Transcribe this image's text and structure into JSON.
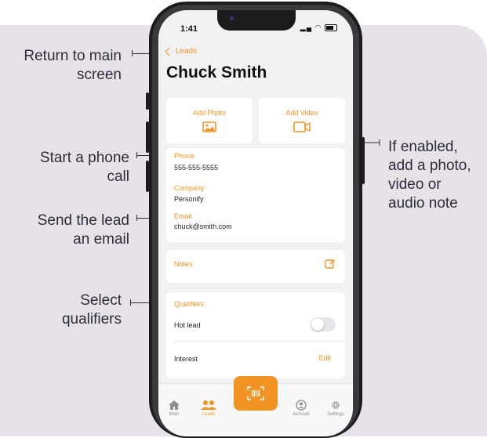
{
  "colors": {
    "accent": "#f29423",
    "background_panel": "#e7e2ea",
    "annotation_text": "#2d2d35"
  },
  "annotations": {
    "return_main": [
      "Return to main",
      "screen"
    ],
    "phone_call": [
      "Start a phone",
      "call"
    ],
    "send_email": [
      "Send the lead",
      "an email"
    ],
    "qualifiers": [
      "Select",
      "qualifiers"
    ],
    "media_note": [
      "If enabled,",
      "add a photo,",
      "video or",
      "audio note"
    ]
  },
  "status_bar": {
    "time": "1:41"
  },
  "nav": {
    "back_label": "Leads"
  },
  "contact": {
    "name": "Chuck Smith",
    "add_photo": "Add Photo",
    "add_video": "Add Video",
    "phone_label": "Phone",
    "phone_value": "555-555-5555",
    "company_label": "Company",
    "company_value": "Personify",
    "email_label": "Email",
    "email_value": "chuck@smith.com",
    "notes_label": "Notes",
    "qualifiers_label": "Qualifiers",
    "hot_lead_label": "Hot lead",
    "hot_lead_enabled": false,
    "interest_label": "Interest",
    "interest_action": "Edit"
  },
  "tabbar": {
    "items": [
      {
        "label": "Main",
        "icon": "home-icon",
        "active": false
      },
      {
        "label": "Leads",
        "icon": "people-icon",
        "active": true
      },
      {
        "label": "",
        "icon": "scan-icon",
        "active": false
      },
      {
        "label": "Account",
        "icon": "account-icon",
        "active": false
      },
      {
        "label": "Settings",
        "icon": "gear-icon",
        "active": false
      }
    ]
  }
}
